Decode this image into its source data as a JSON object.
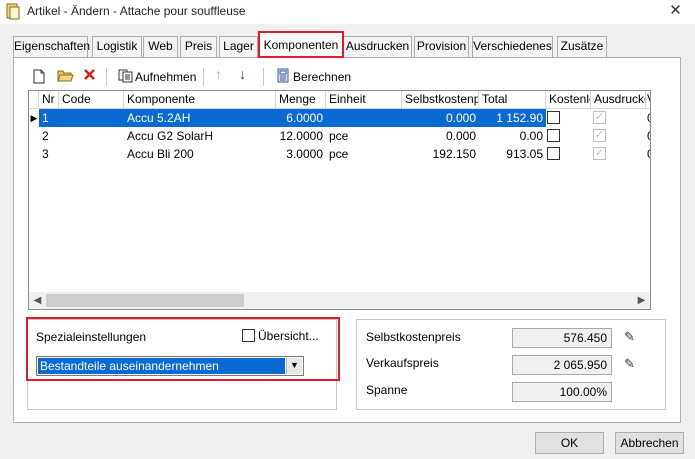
{
  "window": {
    "title": "Artikel - Ändern - Attache pour souffleuse",
    "close_glyph": "✕"
  },
  "tabs": [
    {
      "label": "Eigenschaften",
      "active": false
    },
    {
      "label": "Logistik",
      "active": false
    },
    {
      "label": "Web",
      "active": false
    },
    {
      "label": "Preis",
      "active": false
    },
    {
      "label": "Lager",
      "active": false
    },
    {
      "label": "Komponenten",
      "active": true
    },
    {
      "label": "Ausdrucken",
      "active": false
    },
    {
      "label": "Provision",
      "active": false
    },
    {
      "label": "Verschiedenes",
      "active": false
    },
    {
      "label": "Zusätze",
      "active": false
    }
  ],
  "toolbar": {
    "new_icon": "new-document-icon",
    "open_icon": "open-folder-icon",
    "delete_icon": "delete-x-icon",
    "aufnehmen_label": "Aufnehmen",
    "berechnen_label": "Berechnen"
  },
  "grid": {
    "columns": [
      "Nr",
      "Code",
      "Komponente",
      "Menge",
      "Einheit",
      "Selbstkostenpreis",
      "Total",
      "Kostenlos",
      "Ausdrucken",
      "V"
    ],
    "rows": [
      {
        "nr": "1",
        "code": "",
        "komponente": "Accu 5.2AH",
        "menge": "6.0000",
        "einheit": "",
        "selbstkostenpreis": "0.000",
        "total": "1 152.90",
        "kostenlos": false,
        "ausdrucken": true,
        "v": "0",
        "selected": true
      },
      {
        "nr": "2",
        "code": "",
        "komponente": "Accu G2 SolarH",
        "menge": "12.0000",
        "einheit": "pce",
        "selbstkostenpreis": "0.000",
        "total": "0.00",
        "kostenlos": false,
        "ausdrucken": true,
        "v": "0",
        "selected": false
      },
      {
        "nr": "3",
        "code": "",
        "komponente": "Accu Bli 200",
        "menge": "3.0000",
        "einheit": "pce",
        "selbstkostenpreis": "192.150",
        "total": "913.05",
        "kostenlos": false,
        "ausdrucken": true,
        "v": "0",
        "selected": false
      }
    ]
  },
  "spezial": {
    "label": "Spezialeinstellungen",
    "uebersicht_label": "Übersicht...",
    "uebersicht_checked": false,
    "dropdown_value": "Bestandteile auseinandernehmen"
  },
  "prices": {
    "selbstkostenpreis_label": "Selbstkostenpreis",
    "selbstkostenpreis_value": "576.450",
    "verkaufspreis_label": "Verkaufspreis",
    "verkaufspreis_value": "2 065.950",
    "spanne_label": "Spanne",
    "spanne_value": "100.00%"
  },
  "buttons": {
    "ok": "OK",
    "cancel": "Abbrechen"
  },
  "colors": {
    "selection": "#0a6ad3",
    "highlight": "#e31a2a"
  }
}
